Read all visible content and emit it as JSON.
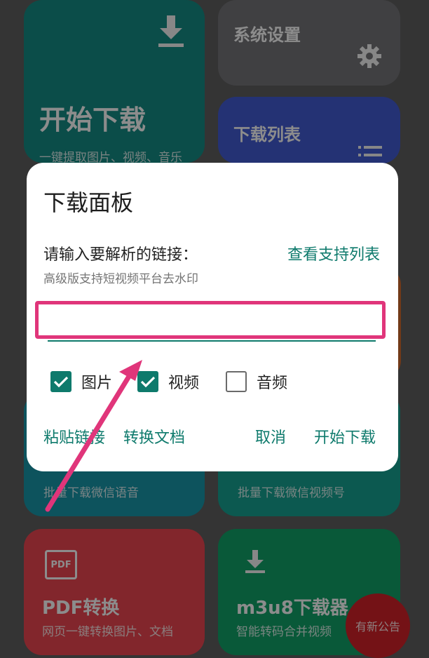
{
  "cards": {
    "start": {
      "title": "开始下载",
      "subtitle": "一键提取图片、视频、音乐",
      "icon": "download-icon"
    },
    "settings": {
      "title": "系统设置",
      "icon": "gear-icon"
    },
    "list": {
      "title": "下载列表",
      "icon": "list-icon"
    },
    "voice": {
      "subtitle": "批量下载微信语音"
    },
    "channel": {
      "subtitle": "批量下载微信视频号"
    },
    "pdf": {
      "title": "PDF转换",
      "subtitle": "网页一键转换图片、文档",
      "icon_text": "PDF",
      "icon": "pdf-icon"
    },
    "m3u8": {
      "title": "m3u8下载器",
      "subtitle": "智能转码合并视频",
      "icon": "download-icon"
    }
  },
  "fab": {
    "label": "有新公告"
  },
  "dialog": {
    "title": "下载面板",
    "prompt": "请输入要解析的链接：",
    "support_link": "查看支持列表",
    "hint": "高级版支持短视频平台去水印",
    "url_value": "",
    "options": [
      {
        "label": "图片",
        "checked": true
      },
      {
        "label": "视频",
        "checked": true
      },
      {
        "label": "音频",
        "checked": false
      }
    ],
    "actions": {
      "paste": "粘贴链接",
      "convert": "转换文档",
      "cancel": "取消",
      "start": "开始下载"
    }
  },
  "colors": {
    "accent": "#0e7a6c",
    "annotation": "#e0357a"
  }
}
